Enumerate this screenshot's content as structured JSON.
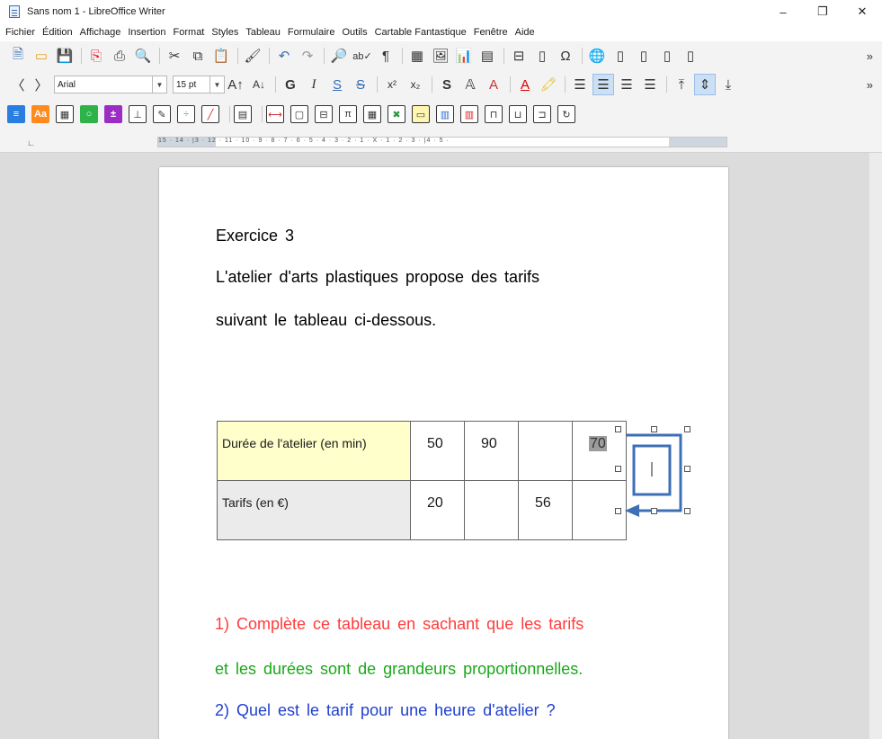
{
  "window": {
    "title": "Sans nom 1 - LibreOffice Writer",
    "controls": [
      "–",
      "❐",
      "✕"
    ]
  },
  "menu": [
    "Fichier",
    "Édition",
    "Affichage",
    "Insertion",
    "Format",
    "Styles",
    "Tableau",
    "Formulaire",
    "Outils",
    "Cartable Fantastique",
    "Fenêtre",
    "Aide"
  ],
  "toolbar2": {
    "font_name": "Arial",
    "font_size": "15 pt"
  },
  "ruler": {
    "numbers": "15 · 14 · |3 · 12 · 11 · 10 · 9 · 8 · 7 · 6 · 5 · 4 · 3 · 2 · 1 · X · 1 · 2 · 3 · |4 · 5 ·"
  },
  "document": {
    "heading": "Exercice 3",
    "para_line1": "L'atelier d'arts plastiques propose des tarifs",
    "para_line2": "suivant le tableau ci-dessous.",
    "table": {
      "row1_label": "Durée de l'atelier (en min)",
      "row1_values": [
        "50",
        "90",
        "",
        "70"
      ],
      "row2_label": "Tarifs (en €)",
      "row2_values": [
        "20",
        "",
        "56",
        ""
      ]
    },
    "q1_line1": "1) Complète ce tableau en sachant que les tarifs",
    "q1_line2": "et les durées sont de grandeurs proportionnelles.",
    "q2": "2) Quel est le tarif pour une heure d'atelier ?",
    "colors": {
      "q1_line1": "#ff3b3b",
      "q1_line2": "#1aa81a",
      "q2": "#2040d0",
      "row1_bg": "#ffffcc",
      "row2_bg": "#ebebeb",
      "arrow": "#3d6fb6"
    }
  }
}
